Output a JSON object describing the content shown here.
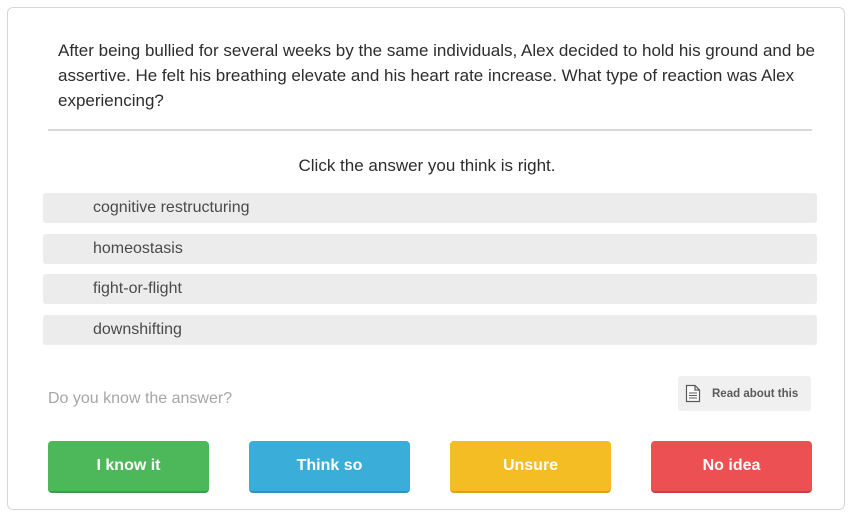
{
  "question": {
    "text": "After being bullied for several weeks by the same individuals, Alex decided to hold his ground and be assertive. He felt his breathing elevate and his heart rate increase. What type of reaction was Alex experiencing?"
  },
  "prompt": "Click the answer you think is right.",
  "answers": [
    {
      "label": "cognitive restructuring"
    },
    {
      "label": "homeostasis"
    },
    {
      "label": "fight-or-flight"
    },
    {
      "label": "downshifting"
    }
  ],
  "confidence": {
    "question_label": "Do you know the answer?",
    "read_about_label": "Read about this",
    "read_about_icon": "document-icon",
    "buttons": [
      {
        "label": "I know it",
        "color": "#4cb85a"
      },
      {
        "label": "Think so",
        "color": "#3badd9"
      },
      {
        "label": "Unsure",
        "color": "#f4bd23"
      },
      {
        "label": "No idea",
        "color": "#ec5052"
      }
    ]
  }
}
